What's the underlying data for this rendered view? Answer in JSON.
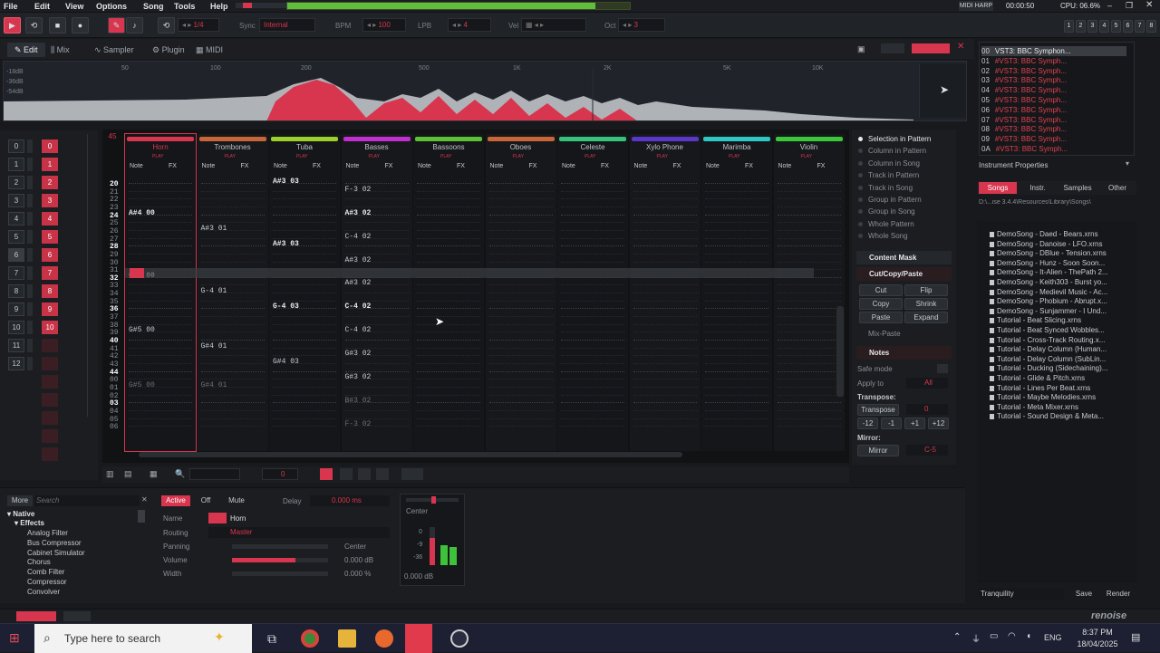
{
  "menu": [
    "File",
    "Edit",
    "View",
    "Options",
    "Song",
    "Tools",
    "Help"
  ],
  "status": {
    "midi": "MIDI HARP",
    "time": "00:00:50",
    "cpu": "CPU: 06.6%"
  },
  "transport": {
    "lines": "1/4",
    "sync_label": "Sync",
    "sync_value": "Internal",
    "bpm_label": "BPM",
    "bpm": "100",
    "lpb_label": "LPB",
    "lpb": "4",
    "vel_label": "Vel",
    "oct_label": "Oct",
    "oct": "3"
  },
  "tracks_top": [
    "1",
    "2",
    "3",
    "4",
    "5",
    "6",
    "7",
    "8"
  ],
  "tabs": [
    "Edit",
    "Mix",
    "Sampler",
    "Plugin",
    "MIDI"
  ],
  "scope": {
    "db": [
      "-18dB",
      "-36dB",
      "-54dB"
    ],
    "freq": [
      "50",
      "100",
      "200",
      "500",
      "1K",
      "2K",
      "5K",
      "10K"
    ]
  },
  "tracks": [
    {
      "name": "Horn",
      "color": "#d8364e"
    },
    {
      "name": "Trombones",
      "color": "#c8663a"
    },
    {
      "name": "Tuba",
      "color": "#9ccf2a"
    },
    {
      "name": "Basses",
      "color": "#c22ed0"
    },
    {
      "name": "Bassoons",
      "color": "#5bc235"
    },
    {
      "name": "Oboes",
      "color": "#c8663a"
    },
    {
      "name": "Celeste",
      "color": "#35c27a"
    },
    {
      "name": "Xylo Phone",
      "color": "#5a37c8"
    },
    {
      "name": "Marimba",
      "color": "#2fc6c4"
    },
    {
      "name": "Violin",
      "color": "#3ac83a"
    }
  ],
  "track_sub": {
    "note": "Note",
    "fx": "FX",
    "play": "PLAY"
  },
  "rows": [
    "20",
    "21",
    "22",
    "23",
    "24",
    "25",
    "26",
    "27",
    "28",
    "29",
    "30",
    "31",
    "32",
    "33",
    "34",
    "35",
    "36",
    "37",
    "38",
    "39",
    "40",
    "41",
    "42",
    "43",
    "44",
    "00",
    "01",
    "02",
    "03",
    "04",
    "05",
    "06"
  ],
  "pattern_num": "45",
  "notes": [
    {
      "t": 0,
      "r": 4,
      "v": "A#4 00",
      "s": "bright"
    },
    {
      "t": 0,
      "r": 12,
      "v": "G-5 00",
      "s": "bright"
    },
    {
      "t": 0,
      "r": 19,
      "v": "G#5 00",
      "s": ""
    },
    {
      "t": 0,
      "r": 26,
      "v": "G#5 00",
      "s": "dim"
    },
    {
      "t": 1,
      "r": 6,
      "v": "A#3 01",
      "s": ""
    },
    {
      "t": 1,
      "r": 14,
      "v": "G-4 01",
      "s": ""
    },
    {
      "t": 1,
      "r": 21,
      "v": "G#4 01",
      "s": ""
    },
    {
      "t": 1,
      "r": 26,
      "v": "G#4 01",
      "s": "dim"
    },
    {
      "t": 2,
      "r": 0,
      "v": "A#3 03",
      "s": "bright"
    },
    {
      "t": 2,
      "r": 8,
      "v": "A#3 03",
      "s": "bright"
    },
    {
      "t": 2,
      "r": 16,
      "v": "G-4 03",
      "s": "bright"
    },
    {
      "t": 2,
      "r": 23,
      "v": "G#4 03",
      "s": ""
    },
    {
      "t": 3,
      "r": 1,
      "v": "F-3 02",
      "s": ""
    },
    {
      "t": 3,
      "r": 4,
      "v": "A#3 02",
      "s": "bright"
    },
    {
      "t": 3,
      "r": 7,
      "v": "C-4 02",
      "s": ""
    },
    {
      "t": 3,
      "r": 10,
      "v": "A#3 02",
      "s": ""
    },
    {
      "t": 3,
      "r": 13,
      "v": "A#3 02",
      "s": ""
    },
    {
      "t": 3,
      "r": 16,
      "v": "C-4 02",
      "s": "bright"
    },
    {
      "t": 3,
      "r": 19,
      "v": "C-4 02",
      "s": ""
    },
    {
      "t": 3,
      "r": 22,
      "v": "G#3 02",
      "s": ""
    },
    {
      "t": 3,
      "r": 25,
      "v": "G#3 02",
      "s": ""
    },
    {
      "t": 3,
      "r": 28,
      "v": "B#3 02",
      "s": "dim"
    },
    {
      "t": 3,
      "r": 31,
      "v": "F-3 02",
      "s": "dim"
    }
  ],
  "right_panel": {
    "scope_items": [
      "Selection in Pattern",
      "Column in Pattern",
      "Column in Song",
      "Track in Pattern",
      "Track in Song",
      "Group in Pattern",
      "Group in Song",
      "Whole Pattern",
      "Whole Song"
    ],
    "content_mask": "Content Mask",
    "ccp": "Cut/Copy/Paste",
    "ccp_buttons": [
      "Cut",
      "Flip",
      "Copy",
      "Shrink",
      "Paste",
      "Expand"
    ],
    "mix_paste": "Mix-Paste",
    "notes": "Notes",
    "safe_mode": "Safe mode",
    "apply_to": "Apply to",
    "apply_val": "All",
    "transpose_head": "Transpose:",
    "transpose": "Transpose",
    "transpose_val": "0",
    "steps": [
      "-12",
      "-1",
      "+1",
      "+12"
    ],
    "mirror_head": "Mirror:",
    "mirror": "Mirror",
    "mirror_val": "C-5"
  },
  "instruments": [
    {
      "n": "00",
      "name": "VST3: BBC Symphon...",
      "sel": true
    },
    {
      "n": "01",
      "name": "#VST3: BBC Symph...",
      "sel": false
    },
    {
      "n": "02",
      "name": "#VST3: BBC Symph...",
      "sel": false
    },
    {
      "n": "03",
      "name": "#VST3: BBC Symph...",
      "sel": false
    },
    {
      "n": "04",
      "name": "#VST3: BBC Symph...",
      "sel": false
    },
    {
      "n": "05",
      "name": "#VST3: BBC Symph...",
      "sel": false
    },
    {
      "n": "06",
      "name": "#VST3: BBC Symph...",
      "sel": false
    },
    {
      "n": "07",
      "name": "#VST3: BBC Symph...",
      "sel": false
    },
    {
      "n": "08",
      "name": "#VST3: BBC Symph...",
      "sel": false
    },
    {
      "n": "09",
      "name": "#VST3: BBC Symph...",
      "sel": false
    },
    {
      "n": "0A",
      "name": "#VST3: BBC Symph...",
      "sel": false
    }
  ],
  "instrument_props": "Instrument Properties",
  "browser_tabs": [
    "Songs",
    "Instr.",
    "Samples",
    "Other"
  ],
  "browser_path": "D:\\...ise 3.4.4\\Resources\\Library\\Songs\\",
  "browser_items": [
    "DemoSong - Daed - Bears.xrns",
    "DemoSong - Danoise - LFO.xrns",
    "DemoSong - DBlue - Tension.xrns",
    "DemoSong - Hunz - Soon Soon...",
    "DemoSong - It-Alien - ThePath 2...",
    "DemoSong - Keith303 - Burst yo...",
    "DemoSong - Medievil Music - Ac...",
    "DemoSong - Phobium - Abrupt.x...",
    "DemoSong - Sunjammer - I Und...",
    "Tutorial - Beat Slicing.xrns",
    "Tutorial - Beat Synced Wobbles...",
    "Tutorial - Cross-Track Routing.x...",
    "Tutorial - Delay Column (Human...",
    "Tutorial - Delay Column (SubLin...",
    "Tutorial - Ducking (Sidechaining)...",
    "Tutorial - Glide & Pitch.xrns",
    "Tutorial - Lines Per Beat.xrns",
    "Tutorial - Maybe Melodies.xrns",
    "Tutorial - Meta Mixer.xrns",
    "Tutorial - Sound Design & Meta..."
  ],
  "browser_footer": {
    "name": "Tranquility",
    "save": "Save",
    "render": "Render"
  },
  "left_tracks": [
    "0",
    "1",
    "2",
    "3",
    "4",
    "5",
    "6",
    "7",
    "8",
    "9",
    "10",
    "11",
    "12"
  ],
  "left_red": [
    "0",
    "1",
    "2",
    "3",
    "4",
    "5",
    "6",
    "7",
    "8",
    "9",
    "10"
  ],
  "dsp": {
    "more": "More",
    "search": "Search",
    "native": "Native",
    "effects": "Effects",
    "list": [
      "Analog Filter",
      "Bus Compressor",
      "Cabinet Simulator",
      "Chorus",
      "Comb Filter",
      "Compressor",
      "Convolver"
    ]
  },
  "track_props": {
    "active": "Active",
    "off": "Off",
    "mute": "Mute",
    "delay_label": "Delay",
    "delay": "0.000 ms",
    "name_label": "Name",
    "name": "Horn",
    "routing_label": "Routing",
    "routing": "Master",
    "panning_label": "Panning",
    "panning": "Center",
    "volume_label": "Volume",
    "volume": "0.000 dB",
    "width_label": "Width",
    "width": "0.000 %"
  },
  "meter": {
    "pan": "Center",
    "ticks": [
      "0",
      "-9",
      "-36"
    ],
    "db": "0.000 dB"
  },
  "logo": "renoise",
  "taskbar": {
    "search": "Type here to search",
    "lang": "ENG",
    "time": "8:37 PM",
    "date": "18/04/2025"
  },
  "colors": {
    "accent": "#d8364e",
    "bg": "#17191c"
  }
}
